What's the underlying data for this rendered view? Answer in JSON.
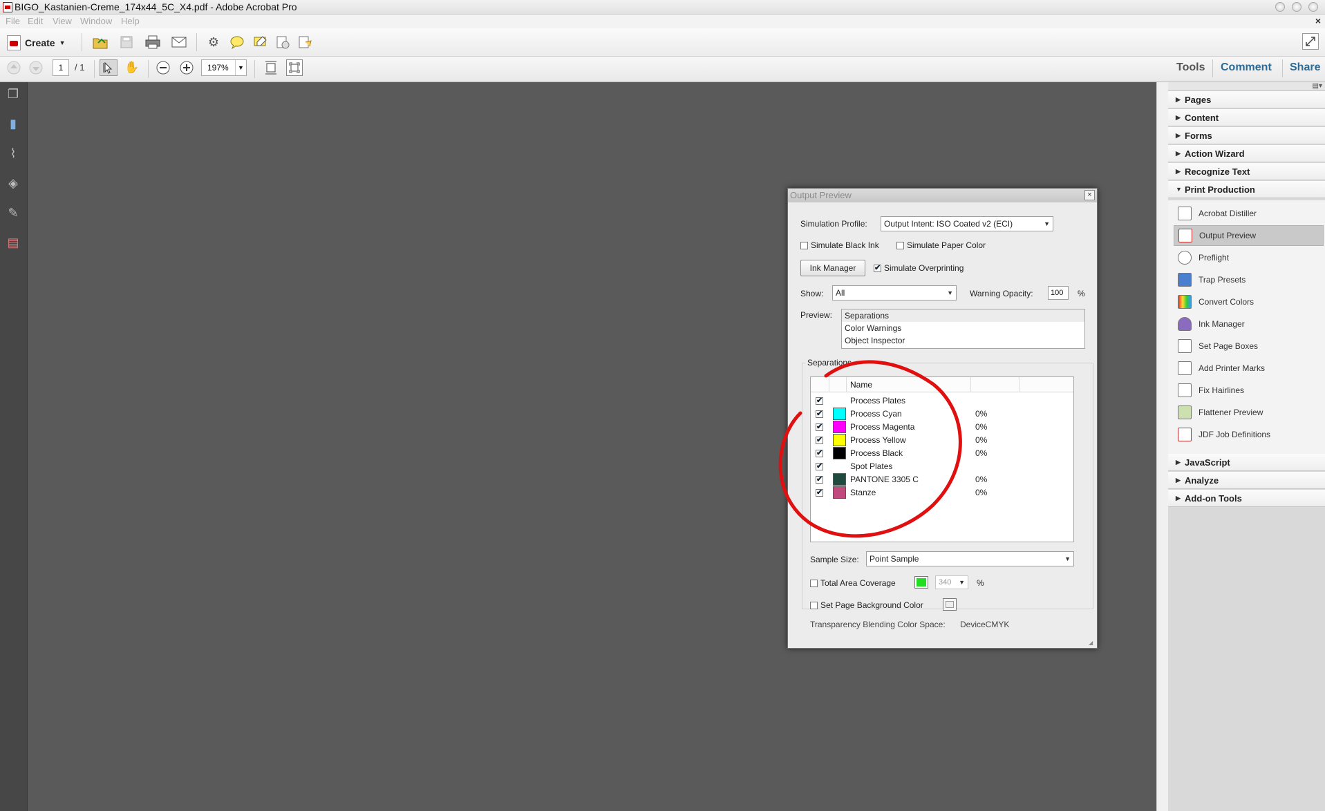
{
  "window": {
    "title": "BIGO_Kastanien-Creme_174x44_5C_X4.pdf - Adobe Acrobat Pro"
  },
  "menu": [
    "File",
    "Edit",
    "View",
    "Window",
    "Help"
  ],
  "toolbar": {
    "create_label": "Create",
    "page_current": "1",
    "page_total": "/ 1",
    "zoom": "197%"
  },
  "top_links": {
    "tools": "Tools",
    "comment": "Comment",
    "share": "Share"
  },
  "right_panels_top": [
    "Pages",
    "Content",
    "Forms",
    "Action Wizard",
    "Recognize Text"
  ],
  "print_production": {
    "header": "Print Production",
    "tools": [
      "Acrobat Distiller",
      "Output Preview",
      "Preflight",
      "Trap Presets",
      "Convert Colors",
      "Ink Manager",
      "Set Page Boxes",
      "Add Printer Marks",
      "Fix Hairlines",
      "Flattener Preview",
      "JDF Job Definitions"
    ],
    "selected": "Output Preview"
  },
  "right_panels_bottom": [
    "JavaScript",
    "Analyze",
    "Add-on Tools"
  ],
  "dialog": {
    "title": "Output Preview",
    "close": "×",
    "simulation_profile_label": "Simulation Profile:",
    "simulation_profile_value": "Output Intent: ISO Coated v2 (ECI)",
    "simulate_black_ink": "Simulate Black Ink",
    "simulate_paper_color": "Simulate Paper Color",
    "ink_manager": "Ink Manager",
    "simulate_overprinting": "Simulate Overprinting",
    "show_label": "Show:",
    "show_value": "All",
    "warning_opacity_label": "Warning Opacity:",
    "warning_opacity_value": "100",
    "percent": "%",
    "preview_label": "Preview:",
    "preview_options": [
      "Separations",
      "Color Warnings",
      "Object Inspector"
    ],
    "separations_label": "Separations",
    "name_header": "Name",
    "separations": [
      {
        "name": "Process Plates",
        "pct": "",
        "color": ""
      },
      {
        "name": "Process Cyan",
        "pct": "0%",
        "color": "#00ffff"
      },
      {
        "name": "Process Magenta",
        "pct": "0%",
        "color": "#ff00ff"
      },
      {
        "name": "Process Yellow",
        "pct": "0%",
        "color": "#ffff00"
      },
      {
        "name": "Process Black",
        "pct": "0%",
        "color": "#000000"
      },
      {
        "name": "Spot Plates",
        "pct": "",
        "color": ""
      },
      {
        "name": "PANTONE 3305 C",
        "pct": "0%",
        "color": "#1f4a3d"
      },
      {
        "name": "Stanze",
        "pct": "0%",
        "color": "#c04a7e"
      }
    ],
    "sample_size_label": "Sample Size:",
    "sample_size_value": "Point Sample",
    "total_area_coverage": "Total Area Coverage",
    "tac_value": "340",
    "tac_color": "#22dd22",
    "set_page_bg": "Set Page Background Color",
    "transparency_label": "Transparency Blending Color Space:",
    "transparency_value": "DeviceCMYK"
  },
  "colors": {
    "annotation_circle": "#e01010"
  }
}
